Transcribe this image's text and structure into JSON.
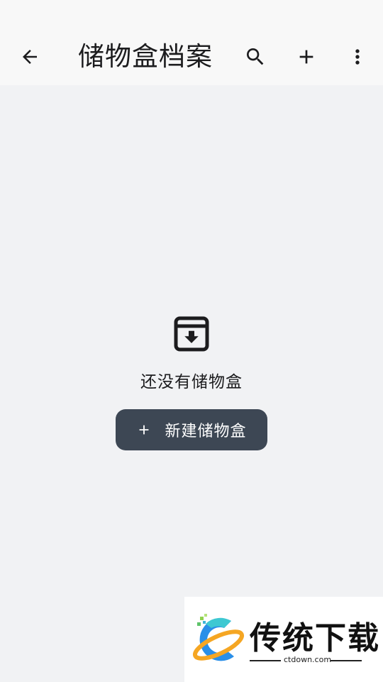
{
  "appbar": {
    "title": "储物盒档案",
    "back_icon": "arrow-back-icon",
    "search_icon": "search-icon",
    "add_icon": "add-icon",
    "more_icon": "more-vert-icon"
  },
  "empty_state": {
    "icon": "archive-box-icon",
    "message": "还没有储物盒",
    "button_label": "新建储物盒",
    "button_icon": "plus-icon",
    "button_color": "#3d4754"
  },
  "watermark": {
    "brand": "传统下载",
    "url": "ctdown.com"
  },
  "colors": {
    "background": "#f1f2f4",
    "appbar": "#f8f8f8",
    "text": "#1c1c1e"
  }
}
